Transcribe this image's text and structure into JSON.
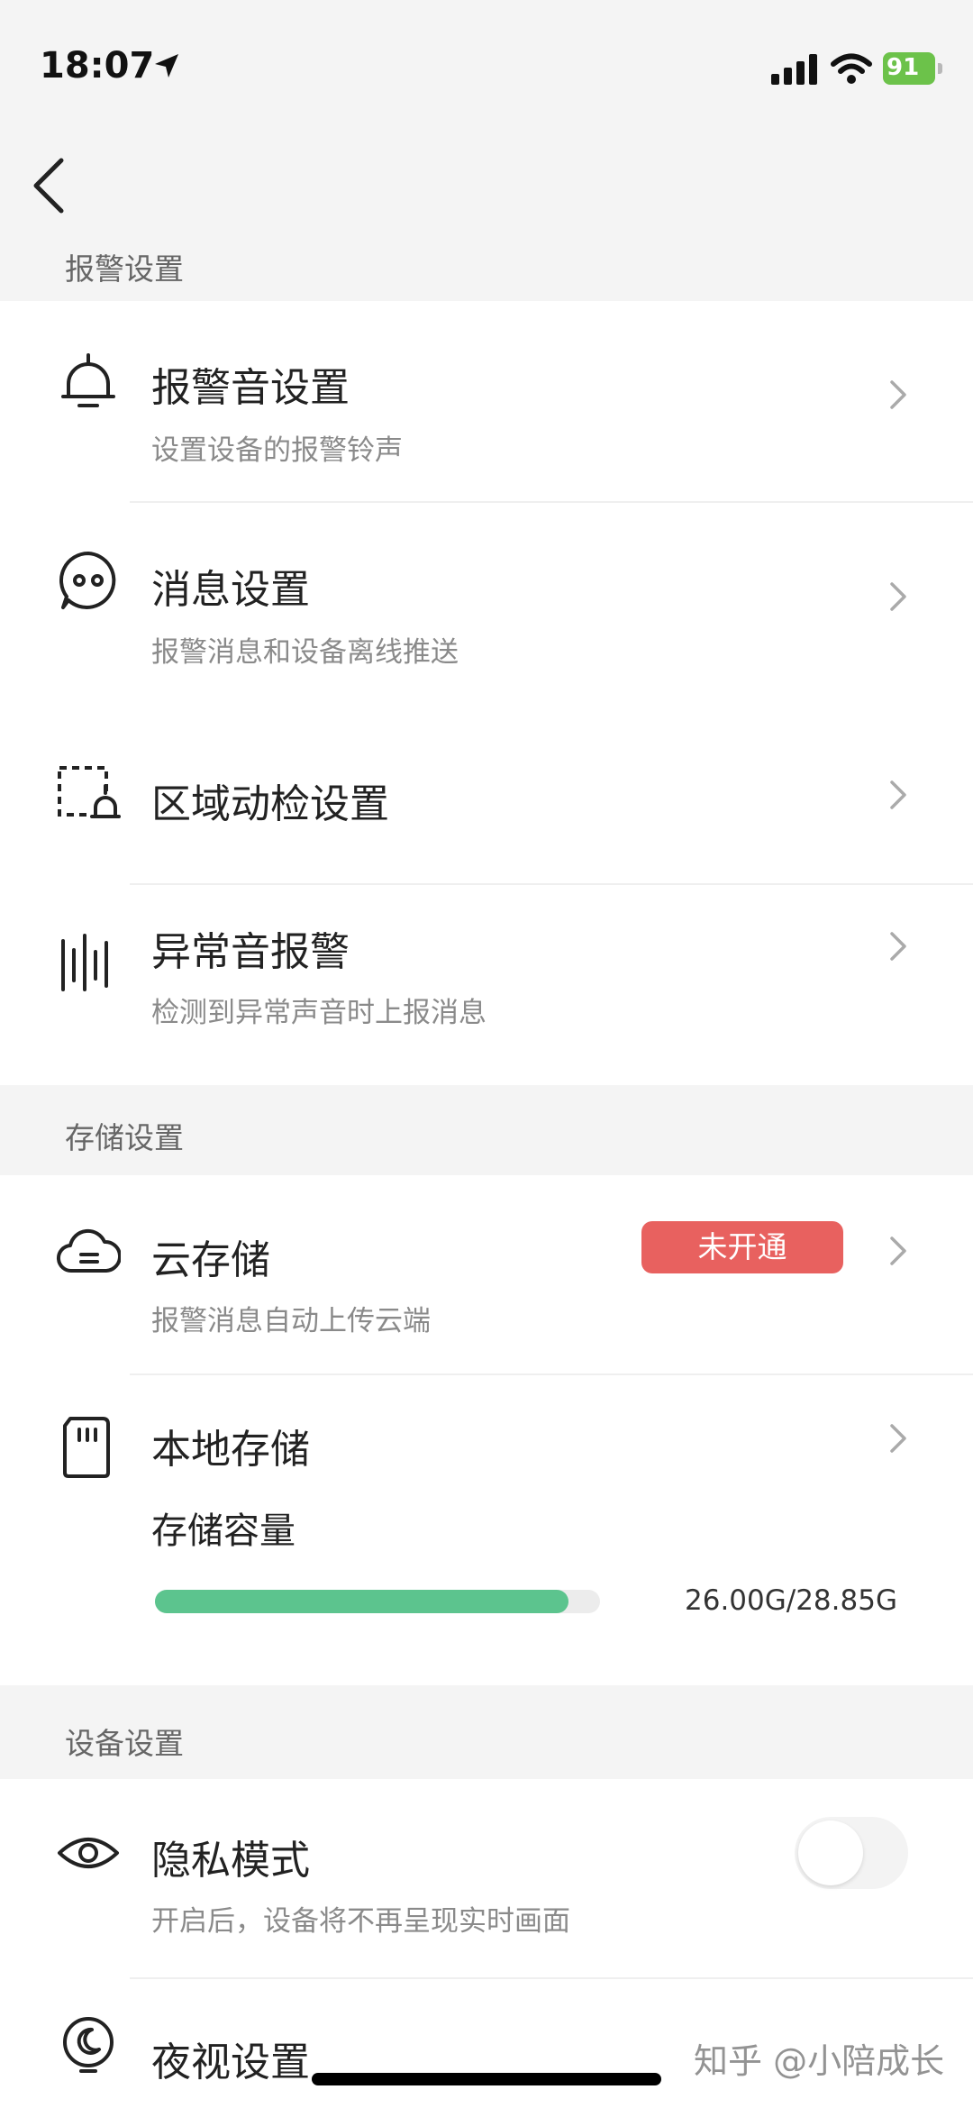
{
  "status_bar": {
    "time": "18:07",
    "battery": "91"
  },
  "sections": {
    "alarm": {
      "title": "报警设置",
      "items": [
        {
          "title": "报警音设置",
          "subtitle": "设置设备的报警铃声",
          "icon": "bell-icon"
        },
        {
          "title": "消息设置",
          "subtitle": "报警消息和设备离线推送",
          "icon": "message-icon"
        },
        {
          "title": "区域动检设置",
          "icon": "motion-zone-icon"
        },
        {
          "title": "异常音报警",
          "subtitle": "检测到异常声音时上报消息",
          "icon": "sound-wave-icon"
        }
      ]
    },
    "storage": {
      "title": "存储设置",
      "cloud": {
        "title": "云存储",
        "subtitle": "报警消息自动上传云端",
        "badge": "未开通",
        "icon": "cloud-icon"
      },
      "local": {
        "title": "本地存储",
        "capacity_label": "存储容量",
        "capacity_text": "26.00G/28.85G",
        "used_fraction": 0.93,
        "icon": "sd-card-icon"
      }
    },
    "device": {
      "title": "设备设置",
      "privacy": {
        "title": "隐私模式",
        "subtitle": "开启后，设备将不再呈现实时画面",
        "toggle_on": false,
        "icon": "eye-icon"
      },
      "night": {
        "title": "夜视设置",
        "icon": "night-vision-icon"
      }
    }
  },
  "watermark": "知乎 @小陪成长",
  "colors": {
    "badge": "#e8615f",
    "progress": "#5cc48e",
    "battery": "#6cc24a"
  }
}
